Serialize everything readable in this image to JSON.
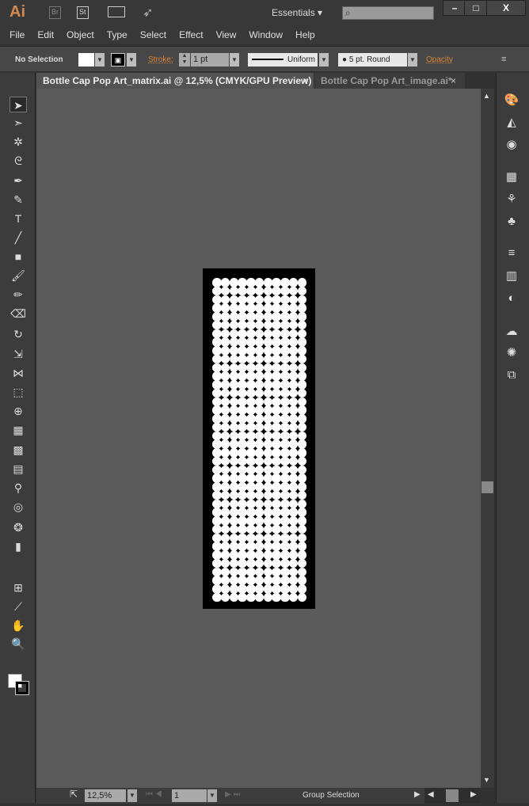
{
  "app": {
    "logo": "Ai",
    "bridge": "Br",
    "stock": "St",
    "workspace": "Essentials",
    "search_placeholder": ""
  },
  "window_buttons": {
    "minimize": "–",
    "maximize": "□",
    "close": "X"
  },
  "menu": [
    "File",
    "Edit",
    "Object",
    "Type",
    "Select",
    "Effect",
    "View",
    "Window",
    "Help"
  ],
  "control": {
    "selection": "No Selection",
    "stroke_label": "Stroke:",
    "stroke_weight": "1 pt",
    "profile": "Uniform",
    "brush": "5 pt. Round",
    "opacity_label": "Opacity"
  },
  "tabs": [
    {
      "label": "Bottle Cap Pop Art_matrix.ai @ 12,5% (CMYK/GPU Preview)",
      "active": true
    },
    {
      "label": "Bottle Cap Pop Art_image.ai*",
      "active": false
    }
  ],
  "tab_close": "×",
  "tools": [
    "selection",
    "direct-selection",
    "magic-wand",
    "lasso",
    "pen",
    "curvature",
    "type",
    "line-segment",
    "rectangle",
    "paintbrush",
    "pencil",
    "eraser",
    "rotate",
    "scale",
    "width",
    "free-transform",
    "shape-builder",
    "perspective-grid",
    "mesh",
    "gradient",
    "eyedropper",
    "blend",
    "symbol-sprayer",
    "column-graph",
    "artboard",
    "slice",
    "hand",
    "zoom"
  ],
  "panels": [
    "color",
    "color-guide",
    "appearance",
    "swatches",
    "brushes",
    "symbols",
    "stroke",
    "gradient",
    "transparency",
    "cc-libraries",
    "asset-export",
    "artboards"
  ],
  "artwork": {
    "columns": 11,
    "rows": 38,
    "fill": "#ffffff",
    "background": "#000000"
  },
  "status": {
    "zoom": "12,5%",
    "artboard": "1",
    "tool": "Group Selection"
  }
}
